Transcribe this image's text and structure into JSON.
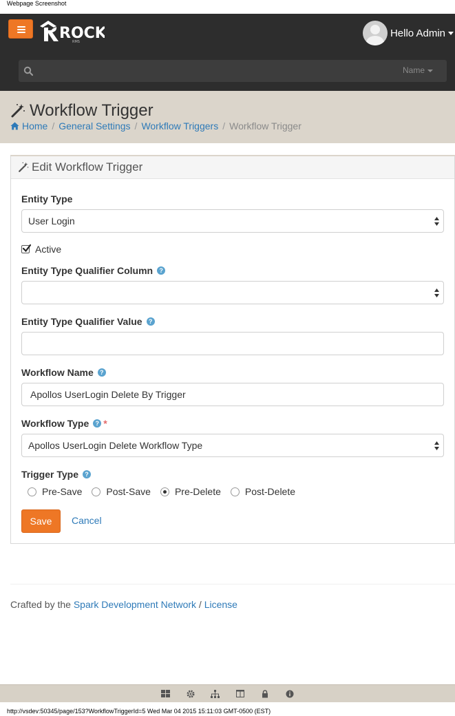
{
  "print": {
    "header_text": "Webpage Screenshot",
    "footer_text": "http://vsdev:50345/page/153?WorkflowTriggerId=5 Wed Mar 04 2015 15:11:03 GMT-0500 (EST)"
  },
  "navbar": {
    "brand": "ROCK",
    "brand_sub": "RMS",
    "user_greeting": "Hello Admin",
    "search": {
      "value": "",
      "placeholder": "",
      "scope": "Name"
    }
  },
  "page": {
    "title": "Workflow Trigger",
    "breadcrumbs": [
      "Home",
      "General Settings",
      "Workflow Triggers",
      "Workflow Trigger"
    ]
  },
  "panel": {
    "heading": "Edit Workflow Trigger",
    "fields": {
      "entity_type": {
        "label": "Entity Type",
        "value": "User Login"
      },
      "active": {
        "label": "Active",
        "checked": true
      },
      "qualifier_column": {
        "label": "Entity Type Qualifier Column",
        "value": ""
      },
      "qualifier_value": {
        "label": "Entity Type Qualifier Value",
        "value": ""
      },
      "workflow_name": {
        "label": "Workflow Name",
        "value": "Apollos UserLogin Delete By Trigger"
      },
      "workflow_type": {
        "label": "Workflow Type",
        "required_mark": "*",
        "value": "Apollos UserLogin Delete Workflow Type"
      },
      "trigger_type": {
        "label": "Trigger Type",
        "options": [
          "Pre-Save",
          "Post-Save",
          "Pre-Delete",
          "Post-Delete"
        ],
        "selected": "Pre-Delete"
      }
    },
    "actions": {
      "save": "Save",
      "cancel": "Cancel"
    }
  },
  "footer": {
    "prefix": "Crafted by the ",
    "link1": "Spark Development Network",
    "sep": " / ",
    "link2": "License"
  },
  "colors": {
    "accent": "#ee7725",
    "link": "#2e7ab8",
    "navbar": "#2d2d2d",
    "header_bg": "#dbd5cb",
    "help": "#5aa3cf",
    "required": "#e46a6a"
  },
  "admin_bar_icons": [
    "grid-icon",
    "gear-icon",
    "sitemap-icon",
    "columns-icon",
    "lock-icon",
    "info-icon"
  ]
}
